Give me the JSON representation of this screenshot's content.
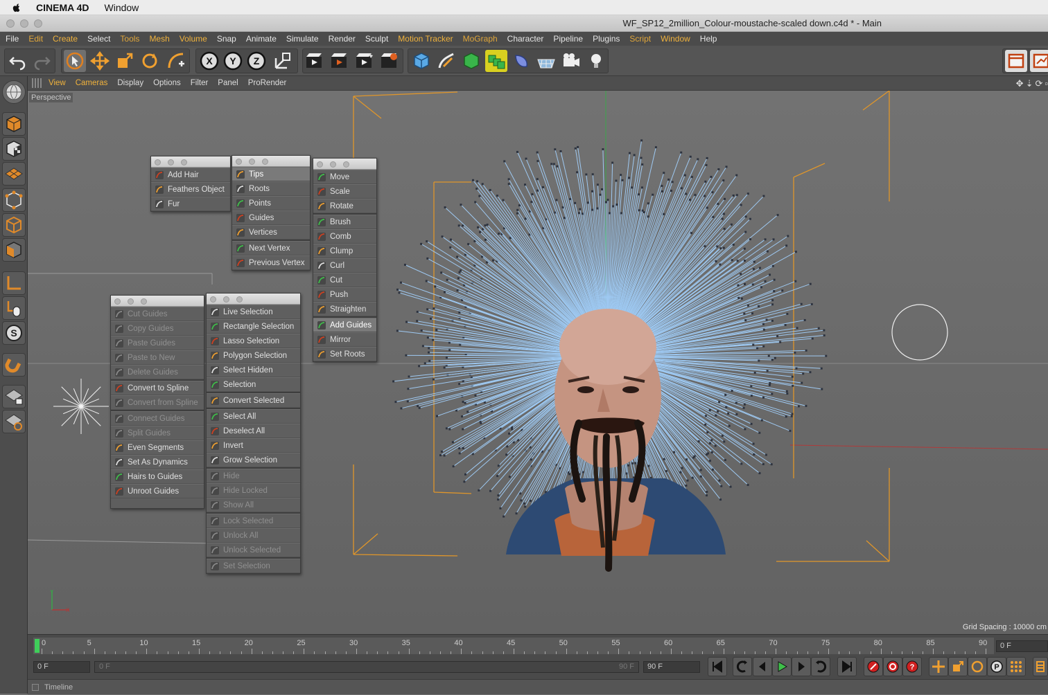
{
  "mac_menu": {
    "app": "CINEMA 4D",
    "items": [
      "Window"
    ]
  },
  "window": {
    "title": "WF_SP12_2million_Colour-moustache-scaled down.c4d * - Main"
  },
  "menubar": {
    "items": [
      {
        "label": "File",
        "color": "#e6e6e6"
      },
      {
        "label": "Edit",
        "color": "#e0a63a"
      },
      {
        "label": "Create",
        "color": "#f0b23c"
      },
      {
        "label": "Select",
        "color": "#e6e6e6"
      },
      {
        "label": "Tools",
        "color": "#e0a63a"
      },
      {
        "label": "Mesh",
        "color": "#f0b23c"
      },
      {
        "label": "Volume",
        "color": "#f0b23c"
      },
      {
        "label": "Snap",
        "color": "#e6e6e6"
      },
      {
        "label": "Animate",
        "color": "#e6e6e6"
      },
      {
        "label": "Simulate",
        "color": "#e6e6e6"
      },
      {
        "label": "Render",
        "color": "#e6e6e6"
      },
      {
        "label": "Sculpt",
        "color": "#e6e6e6"
      },
      {
        "label": "Motion Tracker",
        "color": "#f0b23c"
      },
      {
        "label": "MoGraph",
        "color": "#e0a63a"
      },
      {
        "label": "Character",
        "color": "#e6e6e6"
      },
      {
        "label": "Pipeline",
        "color": "#e6e6e6"
      },
      {
        "label": "Plugins",
        "color": "#e6e6e6"
      },
      {
        "label": "Script",
        "color": "#e0a63a"
      },
      {
        "label": "Window",
        "color": "#f0b23c"
      },
      {
        "label": "Help",
        "color": "#e6e6e6"
      }
    ]
  },
  "toolbar": {
    "undo_icon": "undo-icon",
    "redo_icon": "redo-icon",
    "axis_x": "X",
    "axis_y": "Y",
    "axis_z": "Z"
  },
  "view_menu": {
    "items": [
      {
        "label": "View",
        "color": "#f0b23c"
      },
      {
        "label": "Cameras",
        "color": "#f0b23c"
      },
      {
        "label": "Display",
        "color": "#dddddd"
      },
      {
        "label": "Options",
        "color": "#dddddd"
      },
      {
        "label": "Filter",
        "color": "#dddddd"
      },
      {
        "label": "Panel",
        "color": "#dddddd"
      },
      {
        "label": "ProRender",
        "color": "#dddddd"
      }
    ]
  },
  "viewport": {
    "label": "Perspective",
    "grid_spacing": "Grid Spacing : 10000 cm"
  },
  "palettes": {
    "hair_create": [
      {
        "label": "Add Hair",
        "icon": "add-hair-icon",
        "state": "normal"
      },
      {
        "label": "Feathers Object",
        "icon": "feathers-icon",
        "state": "normal"
      },
      {
        "label": "Fur",
        "icon": "fur-icon",
        "state": "normal"
      }
    ],
    "hair_select_mode": [
      {
        "label": "Tips",
        "icon": "tips-icon",
        "state": "selected"
      },
      {
        "label": "Roots",
        "icon": "roots-icon",
        "state": "normal"
      },
      {
        "label": "Points",
        "icon": "points-icon",
        "state": "normal"
      },
      {
        "label": "Guides",
        "icon": "guides-icon",
        "state": "normal"
      },
      {
        "label": "Vertices",
        "icon": "vertices-icon",
        "state": "normal"
      },
      {
        "sep": true
      },
      {
        "label": "Next Vertex",
        "icon": "next-vertex-icon",
        "state": "normal"
      },
      {
        "label": "Previous Vertex",
        "icon": "previous-vertex-icon",
        "state": "normal"
      }
    ],
    "hair_tools": [
      {
        "label": "Move",
        "icon": "move-icon",
        "state": "normal"
      },
      {
        "label": "Scale",
        "icon": "scale-icon",
        "state": "normal"
      },
      {
        "label": "Rotate",
        "icon": "rotate-icon",
        "state": "normal"
      },
      {
        "sep": true
      },
      {
        "label": "Brush",
        "icon": "brush-icon",
        "state": "normal"
      },
      {
        "label": "Comb",
        "icon": "comb-icon",
        "state": "normal"
      },
      {
        "label": "Clump",
        "icon": "clump-icon",
        "state": "normal"
      },
      {
        "label": "Curl",
        "icon": "curl-icon",
        "state": "normal"
      },
      {
        "label": "Cut",
        "icon": "cut-icon",
        "state": "normal"
      },
      {
        "label": "Push",
        "icon": "push-icon",
        "state": "normal"
      },
      {
        "label": "Straighten",
        "icon": "straighten-icon",
        "state": "normal"
      },
      {
        "sep": true
      },
      {
        "label": "Add Guides",
        "icon": "add-guides-icon",
        "state": "selected"
      },
      {
        "label": "Mirror",
        "icon": "mirror-icon",
        "state": "normal"
      },
      {
        "label": "Set Roots",
        "icon": "set-roots-icon",
        "state": "normal"
      }
    ],
    "guide_ops": [
      {
        "label": "Cut Guides",
        "icon": "cut-guides-icon",
        "state": "disabled"
      },
      {
        "label": "Copy Guides",
        "icon": "copy-guides-icon",
        "state": "disabled"
      },
      {
        "label": "Paste Guides",
        "icon": "paste-guides-icon",
        "state": "disabled"
      },
      {
        "label": "Paste to New",
        "icon": "paste-to-new-icon",
        "state": "disabled"
      },
      {
        "label": "Delete Guides",
        "icon": "delete-guides-icon",
        "state": "disabled"
      },
      {
        "sep": true
      },
      {
        "label": "Convert to Spline",
        "icon": "convert-to-spline-icon",
        "state": "normal"
      },
      {
        "label": "Convert from Spline",
        "icon": "convert-from-spline-icon",
        "state": "disabled"
      },
      {
        "sep": true
      },
      {
        "label": "Connect Guides",
        "icon": "connect-guides-icon",
        "state": "disabled"
      },
      {
        "label": "Split Guides",
        "icon": "split-guides-icon",
        "state": "disabled"
      },
      {
        "label": "Even Segments",
        "icon": "even-segments-icon",
        "state": "normal"
      },
      {
        "label": "Set As Dynamics",
        "icon": "set-as-dynamics-icon",
        "state": "normal"
      },
      {
        "label": "Hairs to Guides",
        "icon": "hairs-to-guides-icon",
        "state": "normal"
      },
      {
        "label": "Unroot Guides",
        "icon": "unroot-guides-icon",
        "state": "normal"
      }
    ],
    "selection_ops": [
      {
        "label": "Live Selection",
        "icon": "live-selection-icon",
        "state": "normal"
      },
      {
        "label": "Rectangle Selection",
        "icon": "rectangle-selection-icon",
        "state": "normal"
      },
      {
        "label": "Lasso Selection",
        "icon": "lasso-selection-icon",
        "state": "normal"
      },
      {
        "label": "Polygon Selection",
        "icon": "polygon-selection-icon",
        "state": "normal"
      },
      {
        "label": "Select Hidden",
        "icon": "select-hidden-icon",
        "state": "normal"
      },
      {
        "label": "Selection",
        "icon": "selection-icon",
        "state": "normal"
      },
      {
        "sep": true
      },
      {
        "label": "Convert Selected",
        "icon": "convert-selected-icon",
        "state": "normal"
      },
      {
        "sep": true
      },
      {
        "label": "Select All",
        "icon": "select-all-icon",
        "state": "normal"
      },
      {
        "label": "Deselect All",
        "icon": "deselect-all-icon",
        "state": "normal"
      },
      {
        "label": "Invert",
        "icon": "invert-icon",
        "state": "normal"
      },
      {
        "label": "Grow Selection",
        "icon": "grow-selection-icon",
        "state": "normal"
      },
      {
        "sep": true
      },
      {
        "label": "Hide",
        "icon": "hide-icon",
        "state": "disabled"
      },
      {
        "label": "Hide Locked",
        "icon": "hide-locked-icon",
        "state": "disabled"
      },
      {
        "label": "Show All",
        "icon": "show-all-icon",
        "state": "disabled"
      },
      {
        "sep": true
      },
      {
        "label": "Lock Selected",
        "icon": "lock-selected-icon",
        "state": "disabled"
      },
      {
        "label": "Unlock All",
        "icon": "unlock-all-icon",
        "state": "disabled"
      },
      {
        "label": "Unlock Selected",
        "icon": "unlock-selected-icon",
        "state": "disabled"
      },
      {
        "sep": true
      },
      {
        "label": "Set Selection",
        "icon": "set-selection-icon",
        "state": "disabled"
      }
    ]
  },
  "timeline": {
    "ticks": [
      "0",
      "5",
      "10",
      "15",
      "20",
      "25",
      "30",
      "35",
      "40",
      "45",
      "50",
      "55",
      "60",
      "65",
      "70",
      "75",
      "80",
      "85",
      "90"
    ],
    "current_frame": "0 F",
    "start_field": "0 F",
    "range_start": "0 F",
    "range_end": "90 F",
    "end_field": "90 F",
    "right_field": "0 F",
    "status_label": "Timeline"
  },
  "colors": {
    "accent": "#f0b23c",
    "hair": "#9ec9f2",
    "hair_tips": "#2e3440",
    "bounds": "#e0962a"
  }
}
